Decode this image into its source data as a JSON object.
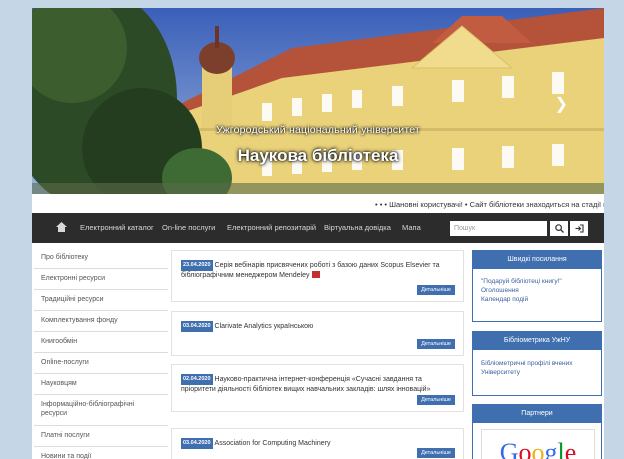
{
  "hero": {
    "subtitle": "Ужгородський національний університет",
    "title": "Наукова бібліотека"
  },
  "ticker": "• • • Шановні користувачі! • Сайт бібліотеки знаходиться на стадії вдос",
  "nav": {
    "items": [
      "Електронний каталог",
      "On-line послуги",
      "Електронний репозитарій",
      "Віртуальна довідка",
      "Мапа"
    ],
    "search_placeholder": "Пошук"
  },
  "sidebar": {
    "items": [
      "Про бібліотеку",
      "Електронні ресурси",
      "Традиційні ресурси",
      "Комплектування фонду",
      "Книгообмін",
      "Online-послуги",
      "Науковцям",
      "Інформаційно-бібліографічні ресурси",
      "Платні послуги",
      "Новини та події"
    ]
  },
  "news": [
    {
      "date": "23.04.2020",
      "text": "Серія вебінарів присвячених роботі з базою даних Scopus Elsevier та бібліографічним менеджером Mendeley",
      "more": "Детальніше"
    },
    {
      "date": "03.04.2020",
      "text": "Clarivate Analytics українською",
      "more": "Детальніше"
    },
    {
      "date": "02.04.2020",
      "text": "Науково-практична інтернет-конференція «Сучасні завдання та пріоритети діяльності бібліотек вищих навчальних закладів: шлях інновацій»",
      "more": "Детальніше"
    },
    {
      "date": "03.04.2020",
      "text": "Association for Computing Machinery",
      "more": "Детальніше"
    }
  ],
  "panels": {
    "quick": {
      "title": "Швидкі посилання",
      "links": [
        "\"Подаруй бібліотеці книгу!\"",
        "Оголошення",
        "Календар подій"
      ]
    },
    "biblio": {
      "title": "Бібліометрика УжНУ",
      "links": [
        "Бібліометричні профілі вчених",
        "Університету"
      ]
    },
    "partners": {
      "title": "Партнери",
      "logo_text": "Google"
    }
  },
  "colors": {
    "accent": "#3f6fae",
    "nav_bg": "#2c2c2c",
    "page_bg": "#c5d6e6"
  }
}
